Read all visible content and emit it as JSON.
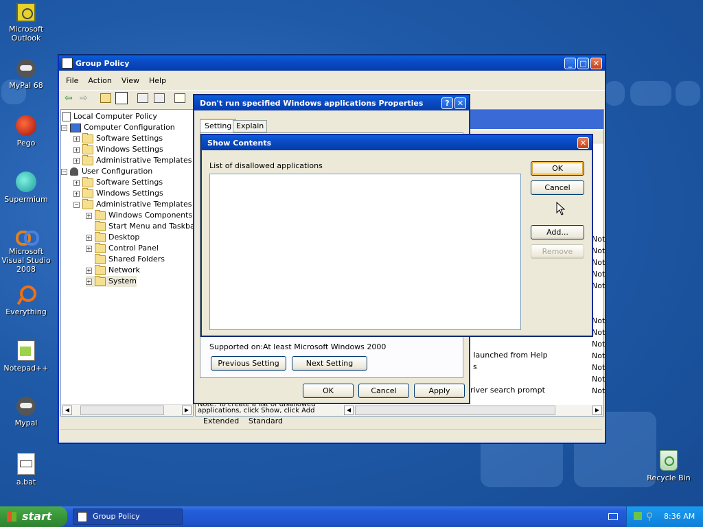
{
  "desktop": {
    "icons": [
      {
        "label": "Microsoft Outlook"
      },
      {
        "label": "MyPal 68"
      },
      {
        "label": "Pego"
      },
      {
        "label": "Supermium"
      },
      {
        "label": "Microsoft Visual Studio 2008"
      },
      {
        "label": "Everything"
      },
      {
        "label": "Notepad++"
      },
      {
        "label": "Mypal"
      },
      {
        "label": "a.bat"
      },
      {
        "label": "Recycle Bin"
      }
    ]
  },
  "gp": {
    "title": "Group Policy",
    "menu": [
      "File",
      "Action",
      "View",
      "Help"
    ],
    "tree": {
      "root": "Local Computer Policy",
      "computer": "Computer Configuration",
      "c_software": "Software Settings",
      "c_windows": "Windows Settings",
      "c_admin": "Administrative Templates",
      "user": "User Configuration",
      "u_software": "Software Settings",
      "u_windows": "Windows Settings",
      "u_admin": "Administrative Templates",
      "wincomp": "Windows Components",
      "startmenu": "Start Menu and Taskbar",
      "desktop": "Desktop",
      "controlpanel": "Control Panel",
      "sharedfolders": "Shared Folders",
      "network": "Network",
      "system": "System"
    },
    "list_fragments": {
      "help_launch": "g launched from Help",
      "s": "s",
      "driver": "river search prompt"
    },
    "not_label": "Not",
    "note_text": "Note: To create a list of disallowed applications, click Show, click Add",
    "tabs": [
      "Extended",
      "Standard"
    ]
  },
  "props": {
    "title": "Don't run specified Windows applications Properties",
    "tabs": [
      "Setting",
      "Explain"
    ],
    "supported_label": "Supported on:",
    "supported_value": "At least Microsoft Windows 2000",
    "prev_button": "Previous Setting",
    "next_button": "Next Setting",
    "ok": "OK",
    "cancel": "Cancel",
    "apply": "Apply"
  },
  "show": {
    "title": "Show Contents",
    "list_label": "List of disallowed applications",
    "ok": "OK",
    "cancel": "Cancel",
    "add": "Add...",
    "remove": "Remove"
  },
  "taskbar": {
    "start": "start",
    "task": "Group Policy",
    "time": "8:36 AM"
  },
  "colors": {
    "title_blue": "#0b4bc4",
    "taskbar_blue": "#245edb",
    "start_green": "#3a9a3a"
  }
}
